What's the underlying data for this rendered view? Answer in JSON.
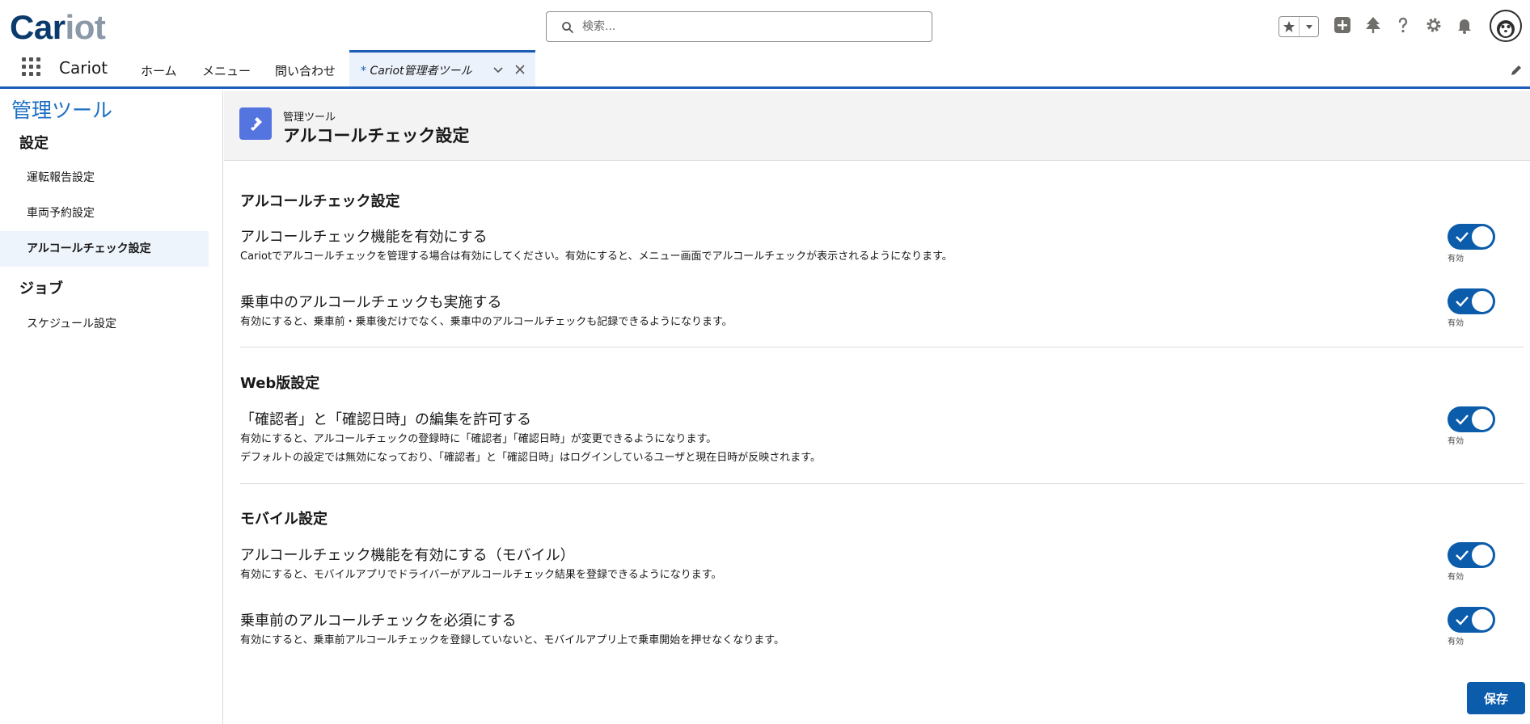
{
  "app": {
    "logo_part1": "Car",
    "logo_part2": "iot"
  },
  "search": {
    "placeholder": "検索..."
  },
  "nav": {
    "app_name": "Cariot",
    "items": [
      {
        "label": "ホーム"
      },
      {
        "label": "メニュー"
      },
      {
        "label": "問い合わせ"
      }
    ],
    "active_tab": {
      "prefix": "* ",
      "label": "Cariot管理者ツール"
    }
  },
  "sidebar": {
    "title": "管理ツール",
    "sections": [
      {
        "title": "設定",
        "items": [
          {
            "label": "運転報告設定",
            "active": false
          },
          {
            "label": "車両予約設定",
            "active": false
          },
          {
            "label": "アルコールチェック設定",
            "active": true
          }
        ]
      },
      {
        "title": "ジョブ",
        "items": [
          {
            "label": "スケジュール設定",
            "active": false
          }
        ]
      }
    ]
  },
  "page_header": {
    "eyebrow": "管理ツール",
    "title": "アルコールチェック設定"
  },
  "sections": [
    {
      "title": "アルコールチェック設定",
      "settings": [
        {
          "label": "アルコールチェック機能を有効にする",
          "description": [
            "Cariotでアルコールチェックを管理する場合は有効にしてください。有効にすると、メニュー画面でアルコールチェックが表示されるようになります。"
          ],
          "enabled": true,
          "state_label": "有効"
        },
        {
          "label": "乗車中のアルコールチェックも実施する",
          "description": [
            "有効にすると、乗車前・乗車後だけでなく、乗車中のアルコールチェックも記録できるようになります。"
          ],
          "enabled": true,
          "state_label": "有効"
        }
      ]
    },
    {
      "title": "Web版設定",
      "settings": [
        {
          "label": "「確認者」と「確認日時」の編集を許可する",
          "description": [
            "有効にすると、アルコールチェックの登録時に「確認者」「確認日時」が変更できるようになります。",
            "デフォルトの設定では無効になっており、「確認者」と「確認日時」はログインしているユーザと現在日時が反映されます。"
          ],
          "enabled": true,
          "state_label": "有効"
        }
      ]
    },
    {
      "title": "モバイル設定",
      "settings": [
        {
          "label": "アルコールチェック機能を有効にする（モバイル）",
          "description": [
            "有効にすると、モバイルアプリでドライバーがアルコールチェック結果を登録できるようになります。"
          ],
          "enabled": true,
          "state_label": "有効"
        },
        {
          "label": "乗車前のアルコールチェックを必須にする",
          "description": [
            "有効にすると、乗車前アルコールチェックを登録していないと、モバイルアプリ上で乗車開始を押せなくなります。"
          ],
          "enabled": true,
          "state_label": "有効"
        }
      ]
    }
  ],
  "actions": {
    "save_label": "保存"
  },
  "colors": {
    "brand": "#0b5cab",
    "link": "#1b6fc2",
    "header_icon": "#5474e0"
  }
}
